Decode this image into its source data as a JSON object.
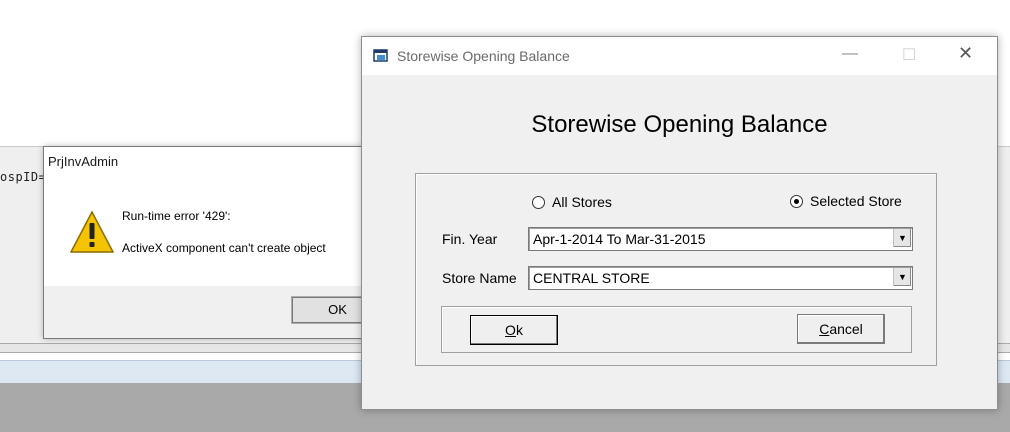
{
  "background": {
    "code_fragment": "ospID="
  },
  "error_dialog": {
    "title": "PrjInvAdmin",
    "close_glyph": "✕",
    "icon": "warning-icon",
    "message_line1": "Run-time error '429':",
    "message_line2": "ActiveX component can't create object",
    "ok_label": "OK"
  },
  "window": {
    "title": "Storewise Opening Balance",
    "icon": "form-icon",
    "minimize_glyph": "—",
    "maximize_glyph": "☐",
    "close_glyph": "✕",
    "heading": "Storewise Opening Balance",
    "radio_all": {
      "label": "All Stores",
      "checked": false
    },
    "radio_selected": {
      "label": "Selected Store",
      "checked": true
    },
    "fin_year": {
      "label": "Fin. Year",
      "value": "Apr-1-2014 To Mar-31-2015"
    },
    "store_name": {
      "label": "Store Name",
      "value": "CENTRAL STORE"
    },
    "ok_accel": "O",
    "ok_rest": "k",
    "cancel_accel": "C",
    "cancel_rest": "ancel"
  },
  "colors": {
    "window_bg": "#f0f0f0",
    "titlebar_bg": "#ffffff",
    "warning_yellow": "#f5c400"
  }
}
